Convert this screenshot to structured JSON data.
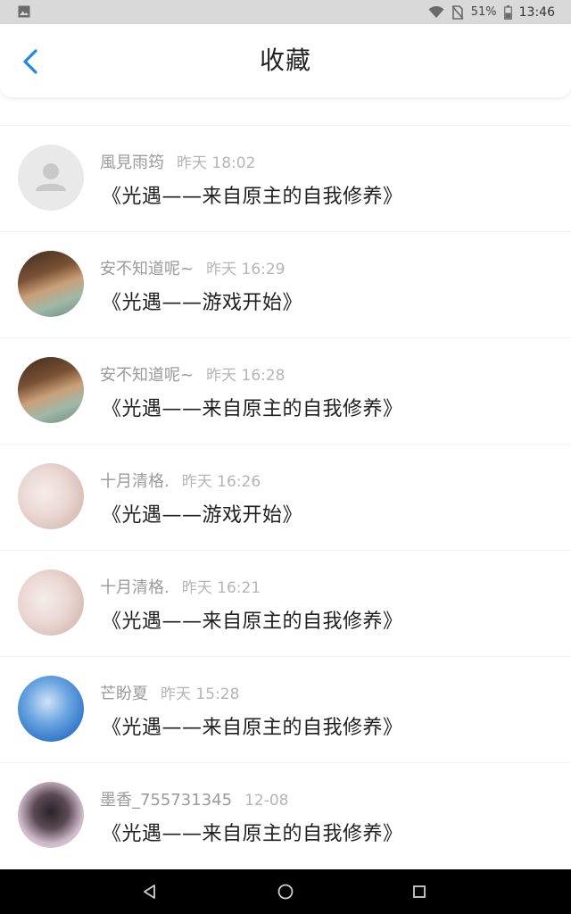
{
  "status": {
    "battery": "51%",
    "time": "13:46"
  },
  "header": {
    "title": "收藏"
  },
  "items": [
    {
      "name": "風見雨筠",
      "time": "昨天 18:02",
      "content": "《光遇——来自原主的自我修养》",
      "avatar": "default-avatar"
    },
    {
      "name": "安不知道呢~",
      "time": "昨天 16:29",
      "content": "《光遇——游戏开始》",
      "avatar": "photo-brown"
    },
    {
      "name": "安不知道呢~",
      "time": "昨天 16:28",
      "content": "《光遇——来自原主的自我修养》",
      "avatar": "photo-brown"
    },
    {
      "name": "十月清格.",
      "time": "昨天 16:26",
      "content": "《光遇——游戏开始》",
      "avatar": "photo-pink"
    },
    {
      "name": "十月清格.",
      "time": "昨天 16:21",
      "content": "《光遇——来自原主的自我修养》",
      "avatar": "photo-pink"
    },
    {
      "name": "芒盼夏",
      "time": "昨天 15:28",
      "content": "《光遇——来自原主的自我修养》",
      "avatar": "photo-sky"
    },
    {
      "name": "墨香_755731345",
      "time": "12-08",
      "content": "《光遇——来自原主的自我修养》",
      "avatar": "photo-anime"
    }
  ],
  "colors": {
    "accent": "#1e88e5",
    "name": "#9a9a9a",
    "time": "#b5b5b5",
    "content": "#1f1f1f"
  }
}
